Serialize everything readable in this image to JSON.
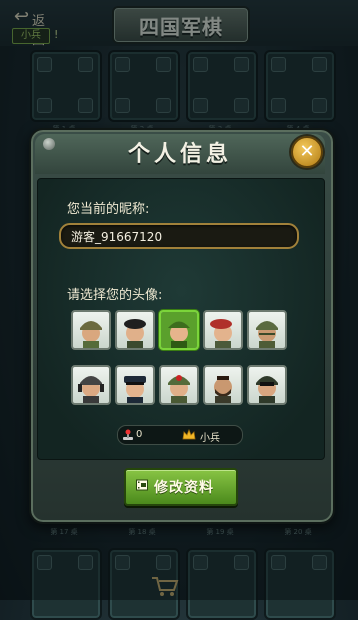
{
  "header": {
    "back_label": "返回",
    "rank_chip": "小兵",
    "rank_mark": "!",
    "game_title": "四国军棋"
  },
  "lobby": {
    "tables_top": [
      "第 1 桌",
      "第 2 桌",
      "第 3 桌",
      "第 4 桌"
    ],
    "tables_bottom": [
      "第 17 桌",
      "第 18 桌",
      "第 19 桌",
      "第 20 桌"
    ]
  },
  "dialog": {
    "title": "个人信息",
    "close_icon": "close-icon",
    "nickname_label": "您当前的昵称:",
    "nickname_value": "游客_91667120",
    "avatar_label": "请选择您的头像:",
    "avatars": [
      {
        "name": "soldier-helmet",
        "selected": false
      },
      {
        "name": "soldier-beret",
        "selected": false
      },
      {
        "name": "soldier-green",
        "selected": true
      },
      {
        "name": "soldier-red-beret",
        "selected": false
      },
      {
        "name": "soldier-camo",
        "selected": false
      },
      {
        "name": "soldier-headset",
        "selected": false
      },
      {
        "name": "officer-cap",
        "selected": false
      },
      {
        "name": "soldier-medic",
        "selected": false
      },
      {
        "name": "soldier-beard",
        "selected": false
      },
      {
        "name": "soldier-night-vision",
        "selected": false
      }
    ],
    "stats": {
      "games_icon": "joystick-icon",
      "games_value": "0",
      "rank_icon": "crown-icon",
      "rank_value": "小兵"
    },
    "edit_button_label": "修改资料"
  },
  "colors": {
    "accent_green": "#6aa832",
    "gold": "#f3c85a",
    "selected_border": "#7bd53a"
  }
}
